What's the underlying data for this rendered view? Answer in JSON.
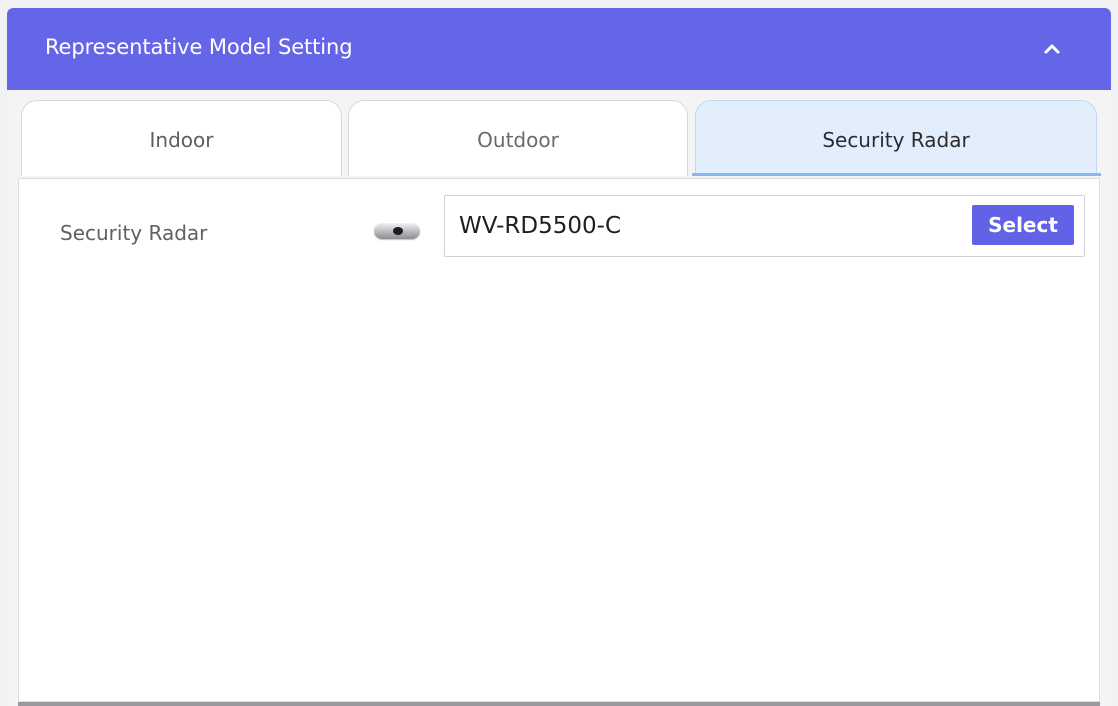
{
  "panel": {
    "title": "Representative Model Setting",
    "collapse_icon": "chevron-up-icon",
    "header_color": "#6565e8"
  },
  "tabs": [
    {
      "label": "Indoor",
      "active": false
    },
    {
      "label": "Outdoor",
      "active": false
    },
    {
      "label": "Security Radar",
      "active": true
    }
  ],
  "content": {
    "field_label": "Security Radar",
    "toggle_icon": "toggle-switch-icon",
    "model_value": "WV-RD5500-C",
    "select_label": "Select",
    "accent_color": "#6262e6"
  }
}
